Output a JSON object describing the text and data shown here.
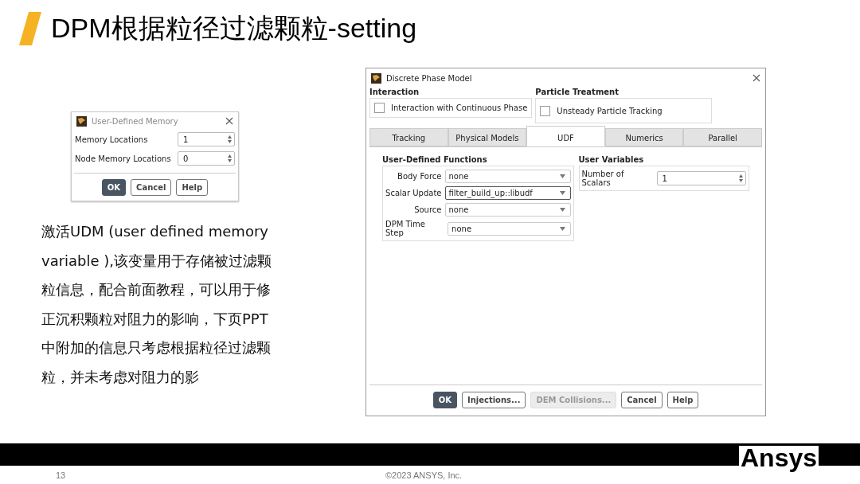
{
  "title": "DPM根据粒径过滤颗粒-setting",
  "udm_dialog": {
    "title": "User-Defined Memory",
    "fields": [
      {
        "label": "Memory Locations",
        "value": "1"
      },
      {
        "label": "Node Memory Locations",
        "value": "0"
      }
    ],
    "buttons": [
      {
        "label": "OK",
        "kind": "primary",
        "disabled": false
      },
      {
        "label": "Cancel",
        "kind": "normal",
        "disabled": false
      },
      {
        "label": "Help",
        "kind": "normal",
        "disabled": false
      }
    ]
  },
  "description": "激活UDM (user defined memory variable ),该变量用于存储被过滤颗粒信息，配合前面教程，可以用于修正沉积颗粒对阻力的影响，下页PPT中附加的信息只考虑根据粒径过滤颗粒，并未考虑对阻力的影",
  "dpm_dialog": {
    "title": "Discrete Phase Model",
    "groups": [
      {
        "heading": "Interaction",
        "checkbox": {
          "label": "Interaction with Continuous Phase",
          "checked": false
        }
      },
      {
        "heading": "Particle Treatment",
        "checkbox": {
          "label": "Unsteady Particle Tracking",
          "checked": false
        }
      }
    ],
    "tabs": [
      {
        "label": "Tracking",
        "selected": false
      },
      {
        "label": "Physical Models",
        "selected": false
      },
      {
        "label": "UDF",
        "selected": true
      },
      {
        "label": "Numerics",
        "selected": false
      },
      {
        "label": "Parallel",
        "selected": false
      }
    ],
    "udf_group": {
      "heading": "User-Defined Functions",
      "rows": [
        {
          "label": "Body Force",
          "value": "none",
          "focused": false
        },
        {
          "label": "Scalar Update",
          "value": "filter_build_up::libudf",
          "focused": true
        },
        {
          "label": "Source",
          "value": "none",
          "focused": false
        },
        {
          "label": "DPM Time Step",
          "value": "none",
          "focused": false
        }
      ]
    },
    "user_variables": {
      "heading": "User Variables",
      "rows": [
        {
          "label": "Number of Scalars",
          "value": "1"
        }
      ]
    },
    "buttons": [
      {
        "label": "OK",
        "kind": "primary",
        "disabled": false
      },
      {
        "label": "Injections...",
        "kind": "normal",
        "disabled": false
      },
      {
        "label": "DEM Collisions...",
        "kind": "normal",
        "disabled": true
      },
      {
        "label": "Cancel",
        "kind": "normal",
        "disabled": false
      },
      {
        "label": "Help",
        "kind": "normal",
        "disabled": false
      }
    ]
  },
  "footer": {
    "page_number": "13",
    "copyright": "©2023 ANSYS, Inc.",
    "logo": "Ansys"
  }
}
